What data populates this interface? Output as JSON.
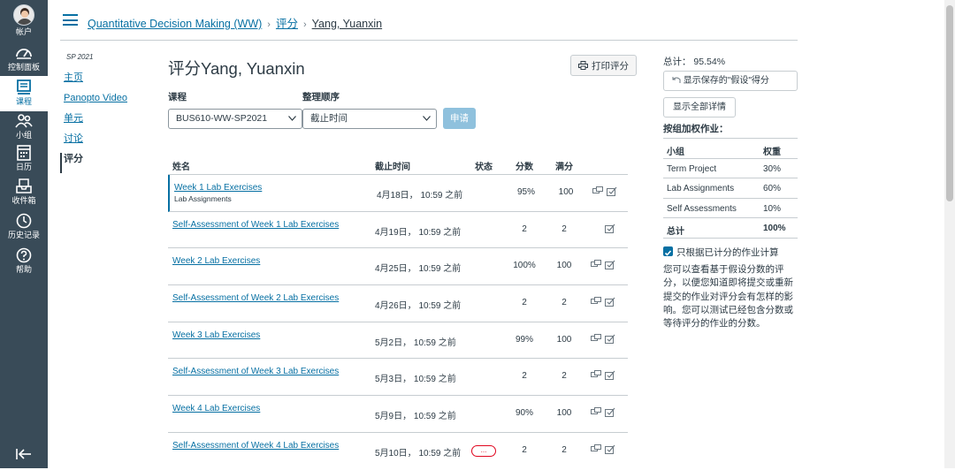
{
  "global_nav": {
    "items": [
      {
        "label": "帐户",
        "icon": "avatar"
      },
      {
        "label": "控制面板",
        "icon": "dashboard-icon"
      },
      {
        "label": "课程",
        "icon": "courses-icon"
      },
      {
        "label": "小组",
        "icon": "groups-icon"
      },
      {
        "label": "日历",
        "icon": "calendar-icon"
      },
      {
        "label": "收件箱",
        "icon": "inbox-icon"
      },
      {
        "label": "历史记录",
        "icon": "history-icon"
      },
      {
        "label": "帮助",
        "icon": "help-icon"
      }
    ]
  },
  "breadcrumb": {
    "course": "Quantitative Decision Making (WW)",
    "section": "评分",
    "student": "Yang, Yuanxin"
  },
  "course_nav": {
    "term": "SP 2021",
    "items": [
      {
        "label": "主页"
      },
      {
        "label": "Panopto Video"
      },
      {
        "label": "单元"
      },
      {
        "label": "讨论"
      },
      {
        "label": "评分"
      }
    ]
  },
  "main": {
    "title": "评分Yang, Yuanxin",
    "print_label": "打印评分",
    "course_label": "课程",
    "course_value": "BUS610-WW-SP2021",
    "order_label": "整理顺序",
    "order_value": "截止时间",
    "apply_label": "申请"
  },
  "table": {
    "headers": {
      "name": "姓名",
      "due": "截止时间",
      "status": "状态",
      "score": "分数",
      "possible": "满分"
    },
    "rows": [
      {
        "name": "Week 1 Lab Exercises",
        "sub": "Lab Assignments",
        "due": "4月18日，  10:59 之前",
        "status": "",
        "score": "95%",
        "possible": "100"
      },
      {
        "name": "Self-Assessment of Week 1 Lab Exercises",
        "sub": "",
        "due": "4月19日，  10:59 之前",
        "status": "",
        "score": "2",
        "possible": "2"
      },
      {
        "name": "Week 2 Lab Exercises",
        "sub": "",
        "due": "4月25日，  10:59 之前",
        "status": "",
        "score": "100%",
        "possible": "100"
      },
      {
        "name": "Self-Assessment of Week 2 Lab Exercises",
        "sub": "",
        "due": "4月26日，  10:59 之前",
        "status": "",
        "score": "2",
        "possible": "2"
      },
      {
        "name": "Week 3 Lab Exercises",
        "sub": "",
        "due": "5月2日，  10:59 之前",
        "status": "",
        "score": "99%",
        "possible": "100"
      },
      {
        "name": "Self-Assessment of Week 3 Lab Exercises",
        "sub": "",
        "due": "5月3日，  10:59 之前",
        "status": "",
        "score": "2",
        "possible": "2"
      },
      {
        "name": "Week 4 Lab Exercises",
        "sub": "",
        "due": "5月9日，  10:59 之前",
        "status": "",
        "score": "90%",
        "possible": "100"
      },
      {
        "name": "Self-Assessment of Week 4 Lab Exercises",
        "sub": "",
        "due": "5月10日，  10:59 之前",
        "status": "...",
        "score": "2",
        "possible": "2"
      }
    ]
  },
  "sidebar": {
    "total": "总计：  95.54%",
    "whatif_label": "显示保存的\"假设\"得分",
    "show_all_label": "显示全部详情",
    "weights_title": "按组加权作业：",
    "weights_headers": {
      "group": "小组",
      "weight": "权重"
    },
    "weights": [
      {
        "group": "Term Project",
        "weight": "30%"
      },
      {
        "group": "Lab Assignments",
        "weight": "60%"
      },
      {
        "group": "Self Assessments",
        "weight": "10%"
      }
    ],
    "weights_total": {
      "group": "总计",
      "weight": "100%"
    },
    "checkbox_label": "只根据已计分的作业计算",
    "note": "您可以查看基于假设分数的评分，以便您知道即将提交或重新提交的作业对评分会有怎样的影响。您可以测试已经包含分数或等待评分的作业的分数。"
  },
  "colors": {
    "nav_bg": "#394b58",
    "link": "#0770a3",
    "apply_bg": "#8fc1dd",
    "danger": "#e0061f"
  }
}
